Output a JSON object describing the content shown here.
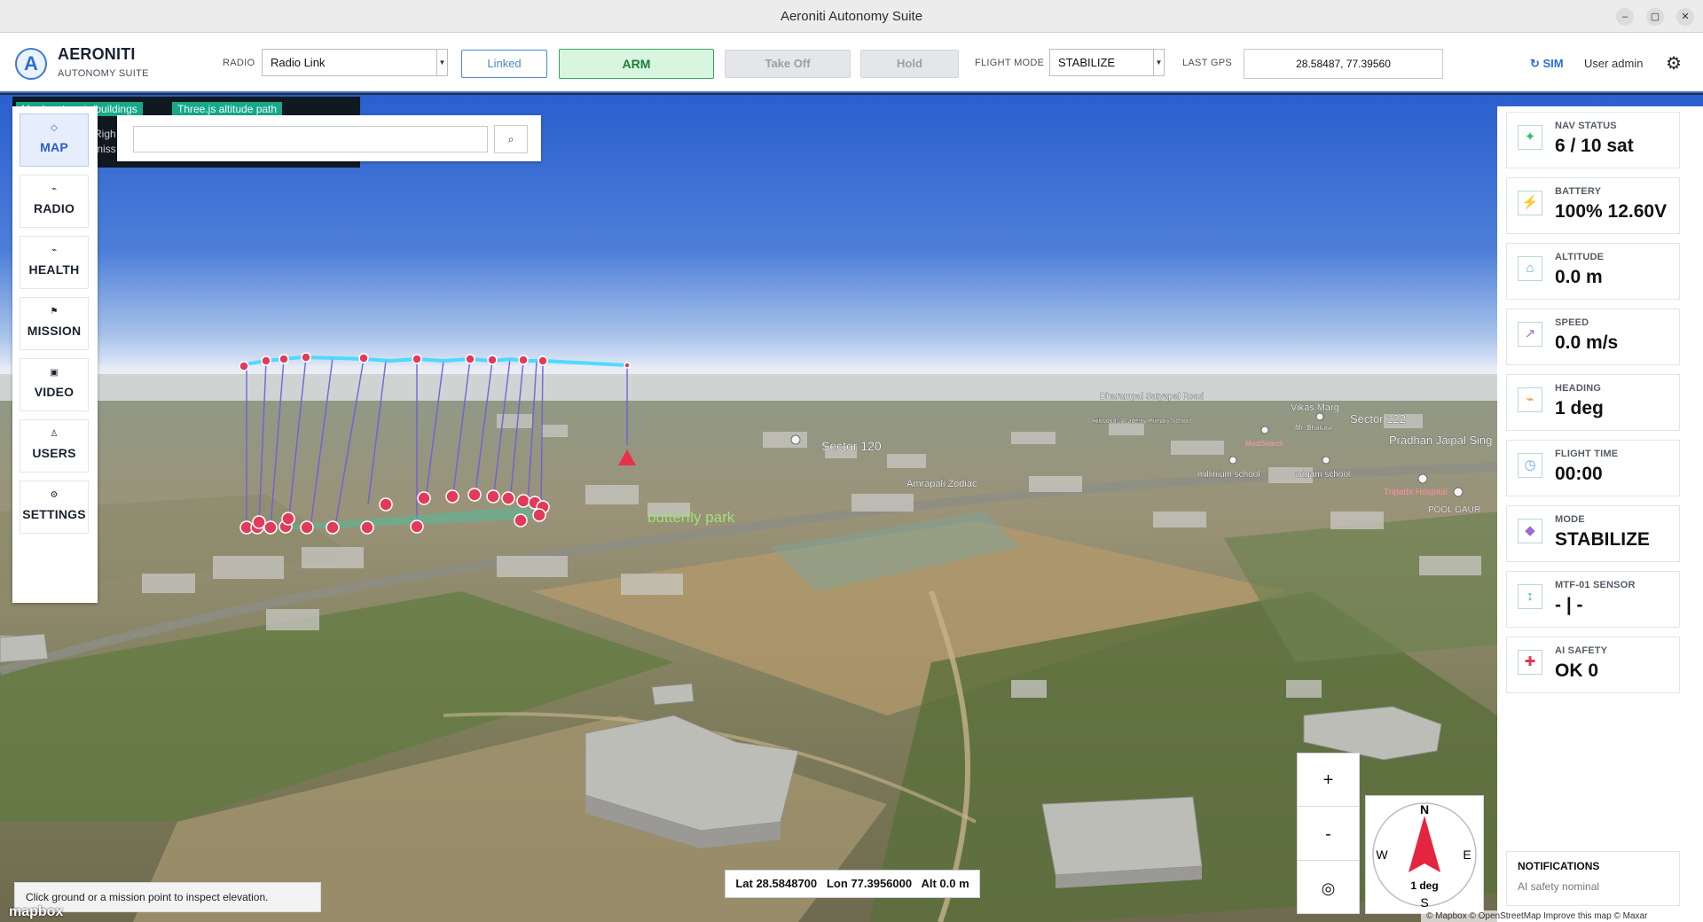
{
  "window": {
    "title": "Aeroniti Autonomy Suite",
    "controls": [
      "–",
      "▢",
      "✕"
    ]
  },
  "brand": {
    "name": "AERONITI",
    "subtitle": "AUTONOMY SUITE",
    "logo_letter": "A"
  },
  "toolbar": {
    "radio_label": "RADIO",
    "radio_value": "Radio Link",
    "linked_label": "Linked",
    "arm_label": "ARM",
    "takeoff_label": "Take Off",
    "hold_label": "Hold",
    "flight_mode_label": "FLIGHT MODE",
    "flight_mode_value": "STABILIZE",
    "last_gps_label": "LAST GPS",
    "last_gps_value": "28.58487, 77.39560",
    "sim_label": "↻ SIM",
    "user_label": "User admin",
    "colors": {
      "accent": "#3e6fd8",
      "arm_bg": "#d7f5df",
      "arm_border": "#3ea55c",
      "linked": "#4a89c8"
    }
  },
  "nav": {
    "items": [
      {
        "icon": "◇",
        "label": "MAP",
        "active": true
      },
      {
        "icon": "⌁",
        "label": "RADIO",
        "active": false
      },
      {
        "icon": "⌁",
        "label": "HEALTH",
        "active": false
      },
      {
        "icon": "⚑",
        "label": "MISSION",
        "active": false
      },
      {
        "icon": "▣",
        "label": "VIDEO",
        "active": false
      },
      {
        "icon": "♙",
        "label": "USERS",
        "active": false
      },
      {
        "icon": "⚙",
        "label": "SETTINGS",
        "active": false
      }
    ]
  },
  "layers": {
    "chip1": "Mapbox terrain/buildings",
    "chip2": "Three.js altitude path",
    "fragment1": "Righ",
    "fragment2": "miss"
  },
  "search": {
    "value": "",
    "button_icon": "⌕"
  },
  "telemetry": [
    {
      "label": "NAV STATUS",
      "value": "6 / 10 sat",
      "icon": "✦",
      "color": "#2fbf71"
    },
    {
      "label": "BATTERY",
      "value": "100% 12.60V",
      "icon": "⚡",
      "color": "#8fd14f"
    },
    {
      "label": "ALTITUDE",
      "value": "0.0 m",
      "icon": "⌂",
      "color": "#5aa9e6"
    },
    {
      "label": "SPEED",
      "value": "0.0 m/s",
      "icon": "↗",
      "color": "#a070d8"
    },
    {
      "label": "HEADING",
      "value": "1 deg",
      "icon": "⌁",
      "color": "#f08c2a"
    },
    {
      "label": "FLIGHT TIME",
      "value": "00:00",
      "icon": "◷",
      "color": "#5aa9e6"
    },
    {
      "label": "MODE",
      "value": "STABILIZE",
      "icon": "◆",
      "color": "#9b6ad6"
    },
    {
      "label": "MTF-01 SENSOR",
      "value": "- | -",
      "icon": "↕",
      "color": "#2ab3a8"
    },
    {
      "label": "AI SAFETY",
      "value": "OK 0",
      "icon": "✚",
      "color": "#e0344f"
    }
  ],
  "notifications": {
    "title": "NOTIFICATIONS",
    "text": "AI safety nominal"
  },
  "map": {
    "labels": {
      "sector120": "Sector 120",
      "sector122": "Sector 122",
      "amrapali": "Amrapali Zodiac",
      "butterfly": "butterfly park",
      "vikas": "Vikas Marg",
      "dharampal": "Dharampal Satyapal Road",
      "pradhan": "Pradhan Jaipal Sing",
      "millinium": "millinium school",
      "udgam": "udgam school",
      "tripathi": "Tripathi Hospital",
      "poolgaur": "POOL GAUR",
      "hillwoods": "Hillwoods Academy Primary School",
      "medisearch": "MediSearch",
      "mrbhatura": "Mr. Bhatura"
    },
    "zoom_in": "+",
    "zoom_out": "-",
    "locate": "◎",
    "compass": {
      "n": "N",
      "s": "S",
      "e": "E",
      "w": "W",
      "heading_text": "1 deg"
    },
    "readout": {
      "lat": "Lat 28.5848700",
      "lon": "Lon 77.3956000",
      "alt": "Alt 0.0 m"
    },
    "hint": "Click ground or a mission point to inspect elevation.",
    "mapbox": "mapbox",
    "attribution": "© Mapbox © OpenStreetMap Improve this map © Maxar"
  }
}
